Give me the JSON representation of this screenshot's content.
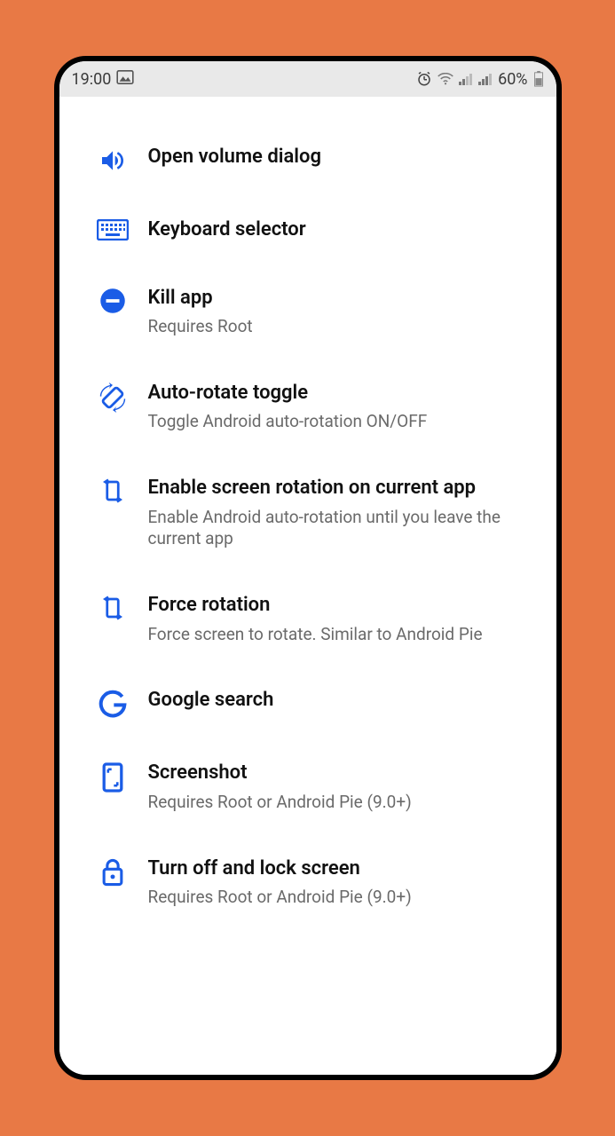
{
  "status": {
    "time": "19:00",
    "battery": "60%"
  },
  "items": [
    {
      "title": "Open volume dialog",
      "sub": ""
    },
    {
      "title": "Keyboard selector",
      "sub": ""
    },
    {
      "title": "Kill app",
      "sub": "Requires Root"
    },
    {
      "title": "Auto-rotate toggle",
      "sub": "Toggle Android auto-rotation ON/OFF"
    },
    {
      "title": "Enable screen rotation on current app",
      "sub": "Enable Android auto-rotation until you leave the current app"
    },
    {
      "title": "Force rotation",
      "sub": "Force screen to rotate. Similar to Android Pie"
    },
    {
      "title": "Google search",
      "sub": ""
    },
    {
      "title": "Screenshot",
      "sub": "Requires Root or Android Pie (9.0+)"
    },
    {
      "title": "Turn off and lock screen",
      "sub": "Requires Root or Android Pie (9.0+)"
    }
  ]
}
